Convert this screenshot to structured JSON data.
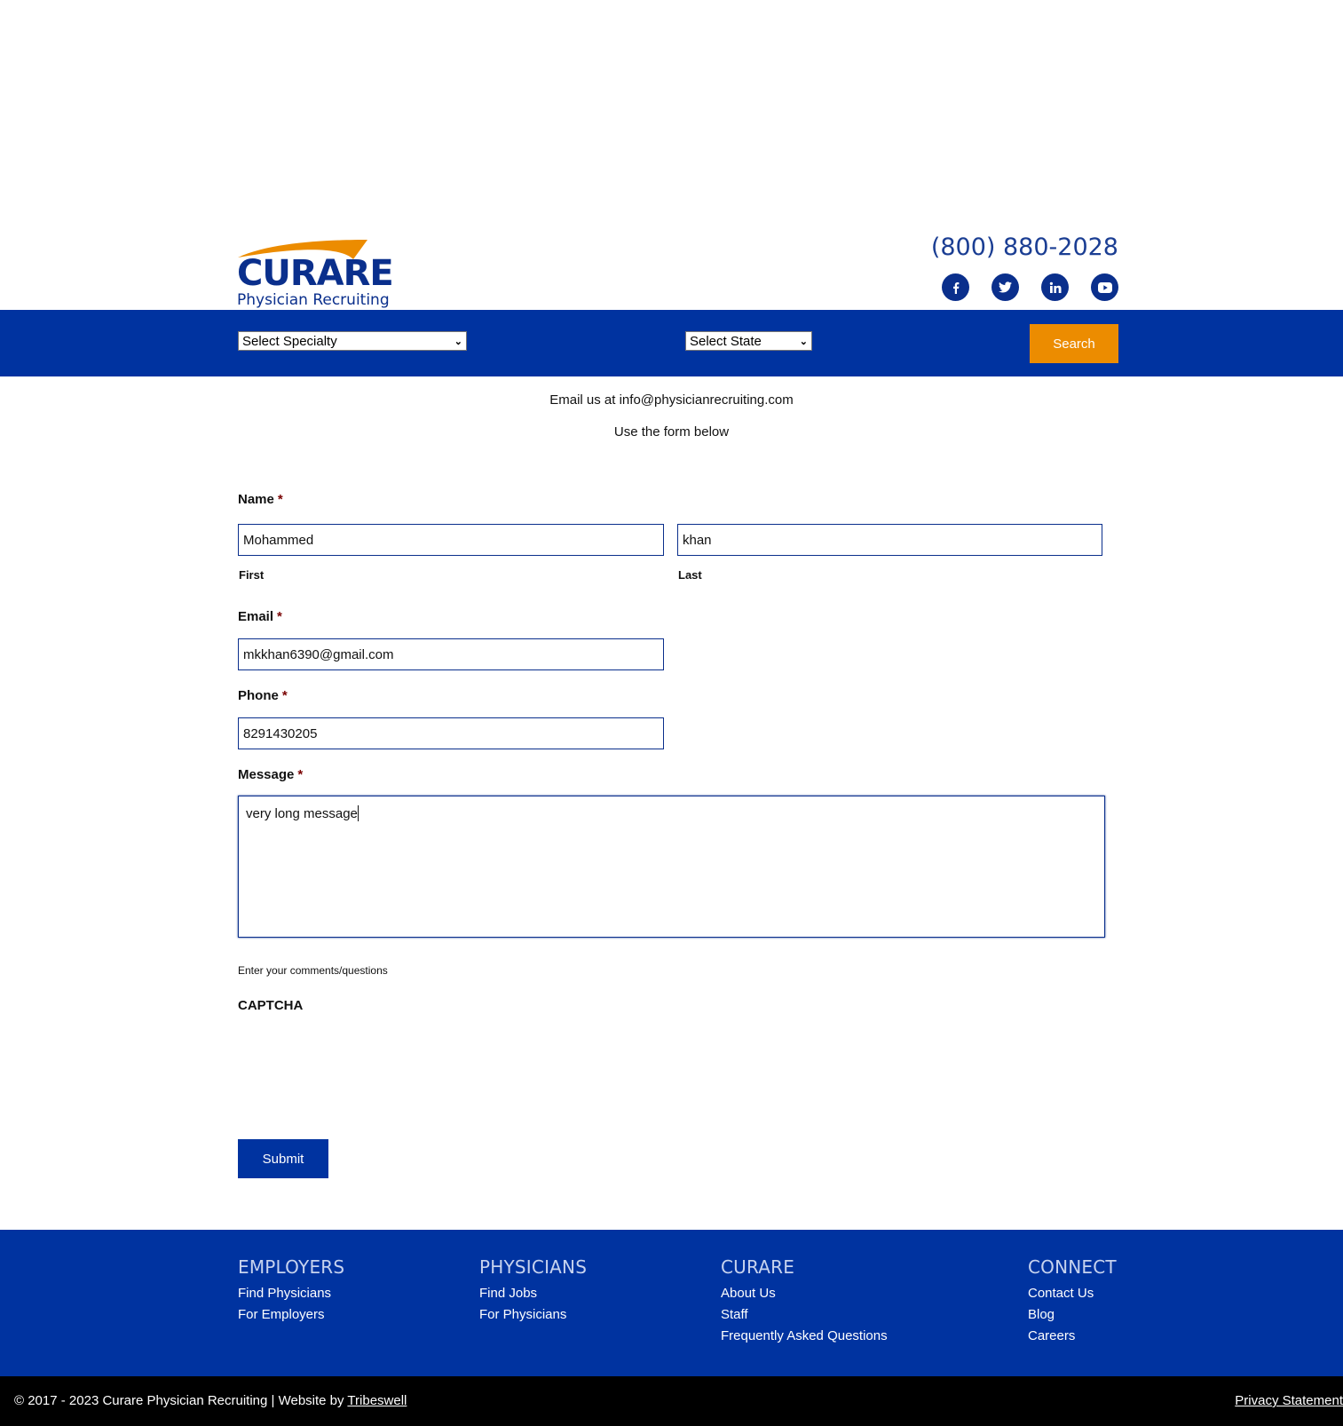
{
  "header": {
    "logo_word": "CURARE",
    "logo_sub": "Physician Recruiting",
    "phone": "(800) 880-2028",
    "social": [
      "facebook-icon",
      "twitter-icon",
      "linkedin-icon",
      "youtube-icon"
    ]
  },
  "search": {
    "specialty": "Select Specialty",
    "state": "Select State",
    "button": "Search"
  },
  "intro": {
    "email_line": "Email us at info@physicianrecruiting.com",
    "form_line": "Use the form below"
  },
  "form": {
    "name_label": "Name",
    "required_mark": "*",
    "first_value": "Mohammed",
    "first_label": "First",
    "last_value": "khan",
    "last_label": "Last",
    "email_label": "Email",
    "email_value": "mkkhan6390@gmail.com",
    "phone_label": "Phone",
    "phone_value": "8291430205",
    "message_label": "Message",
    "message_value": "very long message",
    "message_hint": "Enter your comments/questions",
    "captcha_label": "CAPTCHA",
    "submit": "Submit"
  },
  "footer": {
    "columns": [
      {
        "heading": "EMPLOYERS",
        "links": [
          "Find Physicians",
          "For Employers"
        ]
      },
      {
        "heading": "PHYSICIANS",
        "links": [
          "Find Jobs",
          "For Physicians"
        ]
      },
      {
        "heading": "CURARE",
        "links": [
          "About Us",
          "Staff",
          "Frequently Asked Questions"
        ]
      },
      {
        "heading": "CONNECT",
        "links": [
          "Contact Us",
          "Blog",
          "Careers"
        ]
      }
    ],
    "copyright": "© 2017 - 2023 Curare Physician Recruiting | Website by ",
    "credit_link": "Tribeswell",
    "privacy": "Privacy Statement"
  },
  "colors": {
    "brand_blue": "#0033a0",
    "accent_orange": "#ec8c00",
    "text": "#111111"
  }
}
